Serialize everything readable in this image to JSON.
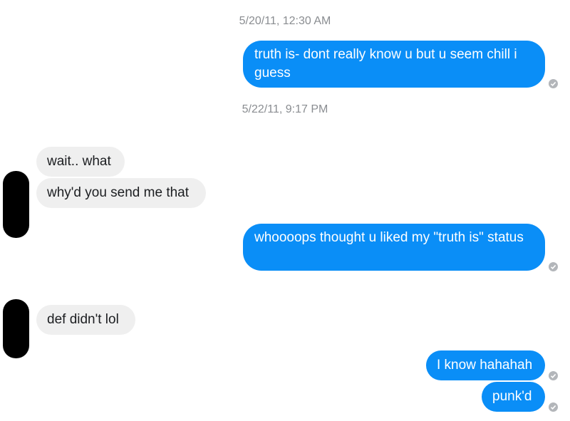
{
  "conversation": {
    "timestamps": [
      "5/20/11, 12:30 AM",
      "5/22/11, 9:17 PM"
    ],
    "messages": [
      {
        "sender": "me",
        "text": "truth is- dont really know u but u seem chill i guess"
      },
      {
        "sender": "them",
        "text": "wait.. what"
      },
      {
        "sender": "them",
        "text": "why'd you send me that"
      },
      {
        "sender": "me",
        "text": "whoooops thought u liked my \"truth is\" status"
      },
      {
        "sender": "them",
        "text": "def didn't lol"
      },
      {
        "sender": "me",
        "text": "I know hahahah"
      },
      {
        "sender": "me",
        "text": "punk'd"
      }
    ]
  },
  "colors": {
    "outgoing_bubble": "#0a8ef7",
    "incoming_bubble": "#efefef",
    "timestamp_text": "#8a8d91",
    "seen_indicator": "#b3b6ba"
  },
  "icons": {
    "seen": "check-circle-icon",
    "avatar": "redacted-avatar"
  }
}
